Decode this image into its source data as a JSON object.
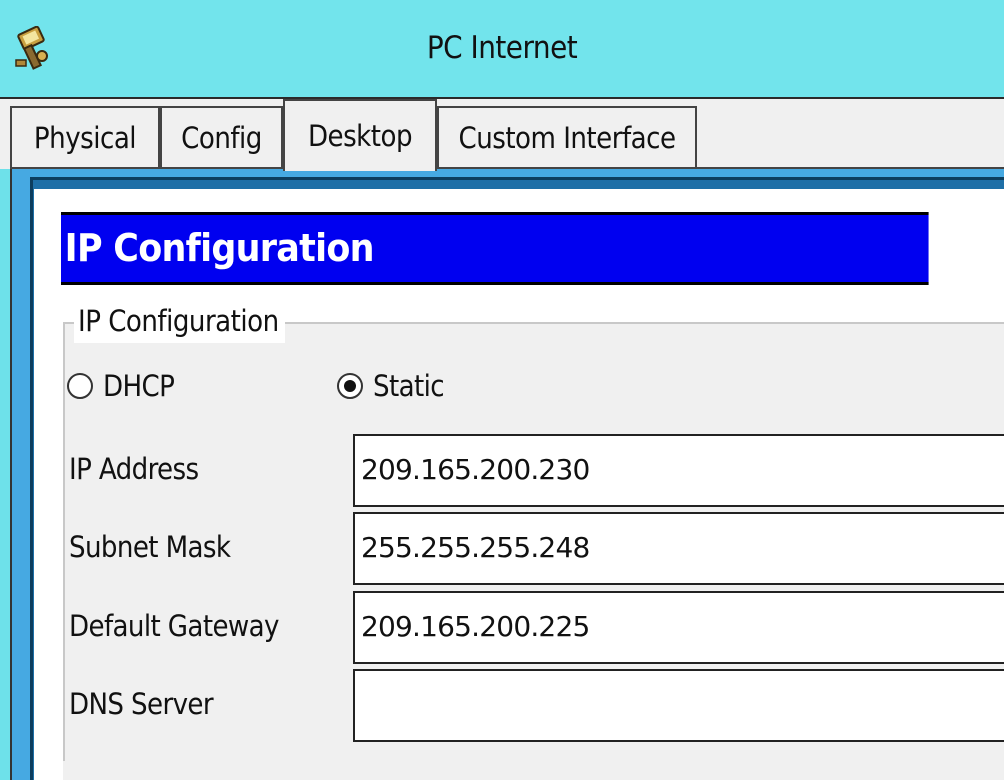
{
  "window": {
    "title": "PC Internet",
    "icon": "pc-network-icon"
  },
  "tabs": [
    {
      "label": "Physical",
      "active": false
    },
    {
      "label": "Config",
      "active": false
    },
    {
      "label": "Desktop",
      "active": true
    },
    {
      "label": "Custom Interface",
      "active": false
    }
  ],
  "ip_config": {
    "header": "IP Configuration",
    "group_label": "IP Configuration",
    "mode_options": [
      {
        "label": "DHCP",
        "selected": false
      },
      {
        "label": "Static",
        "selected": true
      }
    ],
    "fields": [
      {
        "label": "IP Address",
        "value": "209.165.200.230"
      },
      {
        "label": "Subnet Mask",
        "value": "255.255.255.248"
      },
      {
        "label": "Default Gateway",
        "value": "209.165.200.225"
      },
      {
        "label": "DNS Server",
        "value": ""
      }
    ]
  },
  "colors": {
    "titlebar": "#72e4ec",
    "header_bar": "#0000f0",
    "desktop_frame": "#46a9e2"
  }
}
